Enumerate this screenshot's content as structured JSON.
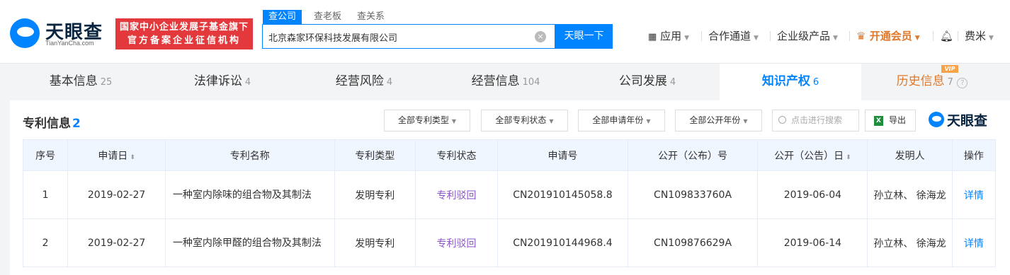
{
  "header": {
    "logo_text": "天眼查",
    "logo_sub": "TianYanCha.com",
    "gov_badge_line1": "国家中小企业发展子基金旗下",
    "gov_badge_line2": "官方备案企业征信机构",
    "search_tabs": [
      "查公司",
      "查老板",
      "查关系"
    ],
    "search_value": "北京森家环保科技发展有限公司",
    "search_button": "天眼一下",
    "nav": [
      "应用",
      "合作通道",
      "企业级产品",
      "开通会员",
      "费米"
    ]
  },
  "tabs": [
    {
      "label": "基本信息",
      "count": "25"
    },
    {
      "label": "法律诉讼",
      "count": "4"
    },
    {
      "label": "经营风险",
      "count": "4"
    },
    {
      "label": "经营信息",
      "count": "104"
    },
    {
      "label": "公司发展",
      "count": "4"
    },
    {
      "label": "知识产权",
      "count": "6"
    },
    {
      "label": "历史信息",
      "count": "7"
    }
  ],
  "vip_tag": "VIP",
  "section": {
    "title": "专利信息",
    "count": "2",
    "filters": [
      "全部专利类型",
      "全部专利状态",
      "全部申请年份",
      "全部公开年份"
    ],
    "search_placeholder": "点击进行搜索",
    "export": "导出",
    "watermark": "天眼查"
  },
  "table": {
    "headers": [
      "序号",
      "申请日",
      "专利名称",
      "专利类型",
      "专利状态",
      "申请号",
      "公开（公布）号",
      "公开（公告）日",
      "发明人",
      "操作"
    ],
    "rows": [
      {
        "no": "1",
        "date": "2019-02-27",
        "name": "一种室内除味的组合物及其制法",
        "type": "发明专利",
        "status": "专利驳回",
        "app_no": "CN201910145058.8",
        "pub_no": "CN109833760A",
        "pub_date": "2019-06-04",
        "inventor": "孙立林、 徐海龙",
        "action": "详情"
      },
      {
        "no": "2",
        "date": "2019-02-27",
        "name": "一种室内除甲醛的组合物及其制法",
        "type": "发明专利",
        "status": "专利驳回",
        "app_no": "CN201910144968.4",
        "pub_no": "CN109876629A",
        "pub_date": "2019-06-14",
        "inventor": "孙立林、 徐海龙",
        "action": "详情"
      }
    ]
  }
}
